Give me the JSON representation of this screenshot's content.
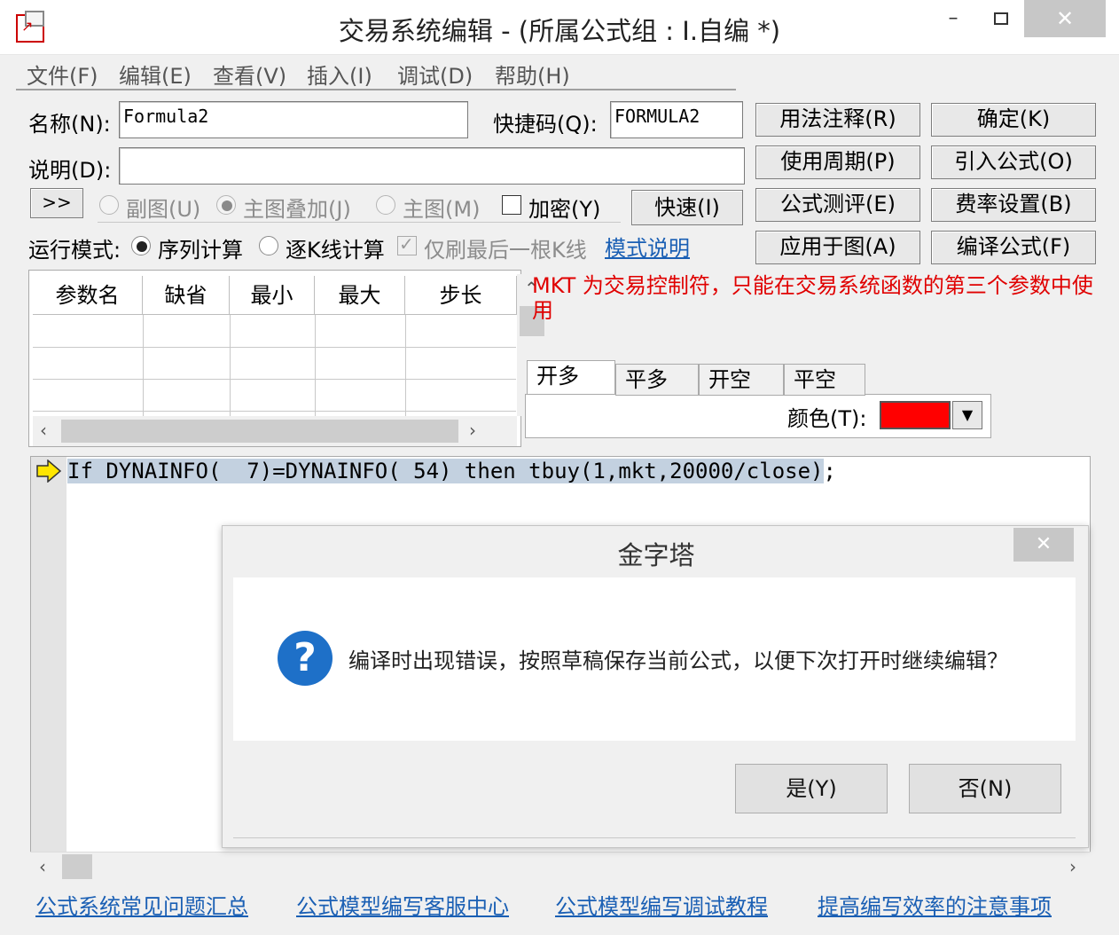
{
  "window": {
    "title": "交易系统编辑 - (所属公式组 : I.自编 *)",
    "min_glyph": "–",
    "close_glyph": "✕"
  },
  "menu": [
    "文件(F)",
    "编辑(E)",
    "查看(V)",
    "插入(I)",
    "调试(D)",
    "帮助(H)"
  ],
  "form": {
    "name_label": "名称(N):",
    "name_value": "Formula2",
    "shortcut_label": "快捷码(Q):",
    "shortcut_value": "FORMULA2",
    "desc_label": "说明(D):",
    "desc_value": "",
    "expand_btn": ">>",
    "sub_chart": "副图(U)",
    "overlay": "主图叠加(J)",
    "main_chart": "主图(M)",
    "encrypt": "加密(Y)",
    "fast_btn": "快速(I)",
    "run_mode_label": "运行模式:",
    "seq_calc": "序列计算",
    "tick_calc": "逐K线计算",
    "last_bar_only": "仅刷最后一根K线",
    "mode_help": "模式说明"
  },
  "right_buttons": [
    "用法注释(R)",
    "确定(K)",
    "使用周期(P)",
    "引入公式(O)",
    "公式测评(E)",
    "费率设置(B)",
    "应用于图(A)",
    "编译公式(F)"
  ],
  "params_table": {
    "columns": [
      "参数名",
      "缺省",
      "最小",
      "最大",
      "步长"
    ],
    "rows": []
  },
  "message": "MKT 为交易控制符，只能在交易系统函数的第三个参数中使用",
  "tabs": [
    "开多",
    "平多",
    "开空",
    "平空"
  ],
  "active_tab": "开多",
  "color_label": "颜色(T):",
  "color_value": "#ff0000",
  "code": {
    "highlighted": "If DYNAINFO(  7)=DYNAINFO( 54) then tbuy(1,mkt,20000/close)",
    "tail": ";"
  },
  "dialog": {
    "title": "金字塔",
    "close_glyph": "✕",
    "icon": "question-icon",
    "message": "编译时出现错误，按照草稿保存当前公式，以便下次打开时继续编辑？",
    "yes": "是(Y)",
    "no": "否(N)"
  },
  "bottom_links": [
    "公式系统常见问题汇总",
    "公式模型编写客服中心",
    "公式模型编写调试教程",
    "提高编写效率的注意事项"
  ]
}
